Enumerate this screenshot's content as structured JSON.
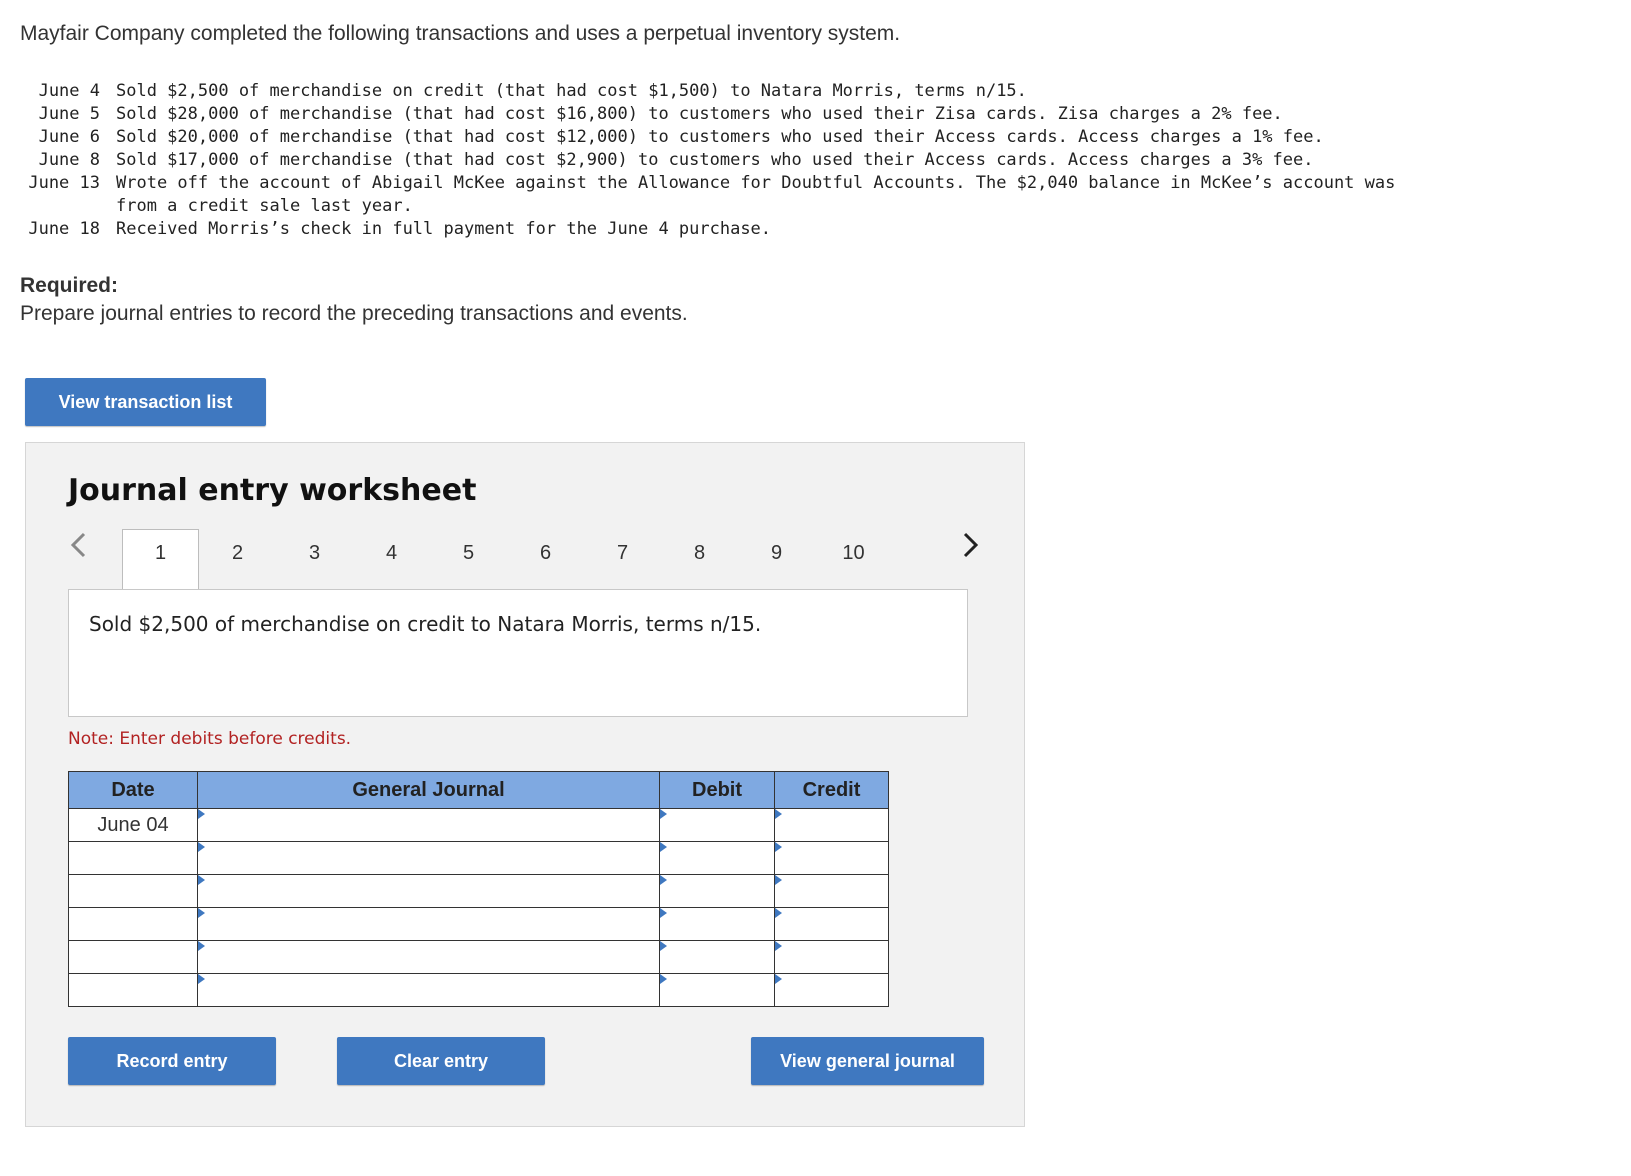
{
  "intro": "Mayfair Company completed the following transactions and uses a perpetual inventory system.",
  "transactions": [
    {
      "date": "June 4",
      "text": "Sold $2,500 of merchandise on credit (that had cost $1,500) to Natara Morris, terms n/15."
    },
    {
      "date": "June 5",
      "text": "Sold $28,000 of merchandise (that had cost $16,800) to customers who used their Zisa cards. Zisa charges a 2% fee."
    },
    {
      "date": "June 6",
      "text": "Sold $20,000 of merchandise (that had cost $12,000) to customers who used their Access cards. Access charges a 1% fee."
    },
    {
      "date": "June 8",
      "text": "Sold $17,000 of merchandise (that had cost $2,900) to customers who used their Access cards. Access charges a 3% fee."
    },
    {
      "date": "June 13",
      "text": "Wrote off the account of Abigail McKee against the Allowance for Doubtful Accounts. The $2,040 balance in McKee’s account was from a credit sale last year."
    },
    {
      "date": "June 18",
      "text": "Received Morris’s check in full payment for the June 4 purchase."
    }
  ],
  "required": {
    "title": "Required:",
    "text": "Prepare journal entries to record the preceding transactions and events."
  },
  "view_transaction_list_label": "View transaction list",
  "worksheet": {
    "title": "Journal entry worksheet",
    "tabs": [
      "1",
      "2",
      "3",
      "4",
      "5",
      "6",
      "7",
      "8",
      "9",
      "10"
    ],
    "active_tab": "1",
    "description": "Sold $2,500 of merchandise on credit to Natara Morris, terms n/15.",
    "note": "Note: Enter debits before credits.",
    "columns": {
      "date": "Date",
      "journal": "General Journal",
      "debit": "Debit",
      "credit": "Credit"
    },
    "rows": [
      {
        "date": "June 04",
        "account": "",
        "debit": "",
        "credit": ""
      },
      {
        "date": "",
        "account": "",
        "debit": "",
        "credit": ""
      },
      {
        "date": "",
        "account": "",
        "debit": "",
        "credit": ""
      },
      {
        "date": "",
        "account": "",
        "debit": "",
        "credit": ""
      },
      {
        "date": "",
        "account": "",
        "debit": "",
        "credit": ""
      },
      {
        "date": "",
        "account": "",
        "debit": "",
        "credit": ""
      }
    ],
    "buttons": {
      "record": "Record entry",
      "clear": "Clear entry",
      "view_journal": "View general journal"
    }
  },
  "colors": {
    "accent": "#3f78c0",
    "header": "#7fa9e1",
    "note": "#b22222"
  },
  "icons": {
    "prev": "chevron-left-icon",
    "next": "chevron-right-icon"
  }
}
